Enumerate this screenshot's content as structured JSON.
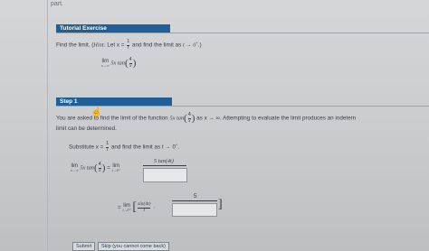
{
  "page": {
    "partial_text": "part."
  },
  "tutorial": {
    "banner": "Tutorial Exercise",
    "prompt_start": "Find the limit. (",
    "hint_label": "Hint:",
    "hint_let": "Let x =",
    "hint_frac_num": "1",
    "hint_frac_den": "t",
    "prompt_mid": "and find the limit as",
    "prompt_limit": "t → 0",
    "prompt_sup": "+",
    "prompt_end": ".)",
    "problem": {
      "lim": "lim",
      "lim_sub": "x→∞",
      "coef": "5x tan",
      "frac_num": "4",
      "frac_den": "x"
    }
  },
  "step": {
    "banner": "Step 1",
    "line1_start": "You are asked to find the limit of the function",
    "line1_func": "5x tan",
    "line1_frac_num": "4",
    "line1_frac_den": "x",
    "line1_mid": "as x → ∞. Attempting to evaluate the limit produces an indetern",
    "line2": "limit can be determined.",
    "subst_start": "Substitute x =",
    "subst_frac_num": "1",
    "subst_frac_den": "t",
    "subst_mid": "and find the limit as t → 0",
    "subst_sup": "+",
    "subst_end": ".",
    "eq1": {
      "lim": "lim",
      "lim_sub": "x→∞",
      "func": "5x tan",
      "frac_num": "4",
      "frac_den": "x",
      "eq": "=",
      "rhs_lim": "lim",
      "rhs_sub": "t→0⁺",
      "rhs_num": "5 tan(4t)",
      "box_value": ""
    },
    "eq2": {
      "eq": "=",
      "lim": "lim",
      "lim_sub": "t→0⁺",
      "bracket_open": "[",
      "frac_num": "sin(4t)",
      "frac_den": "t",
      "dot": "·",
      "num5": "5",
      "bracket_close": "]",
      "box_value": ""
    }
  },
  "buttons": {
    "submit": "Submit",
    "skip": "Skip (you cannot come back)"
  }
}
